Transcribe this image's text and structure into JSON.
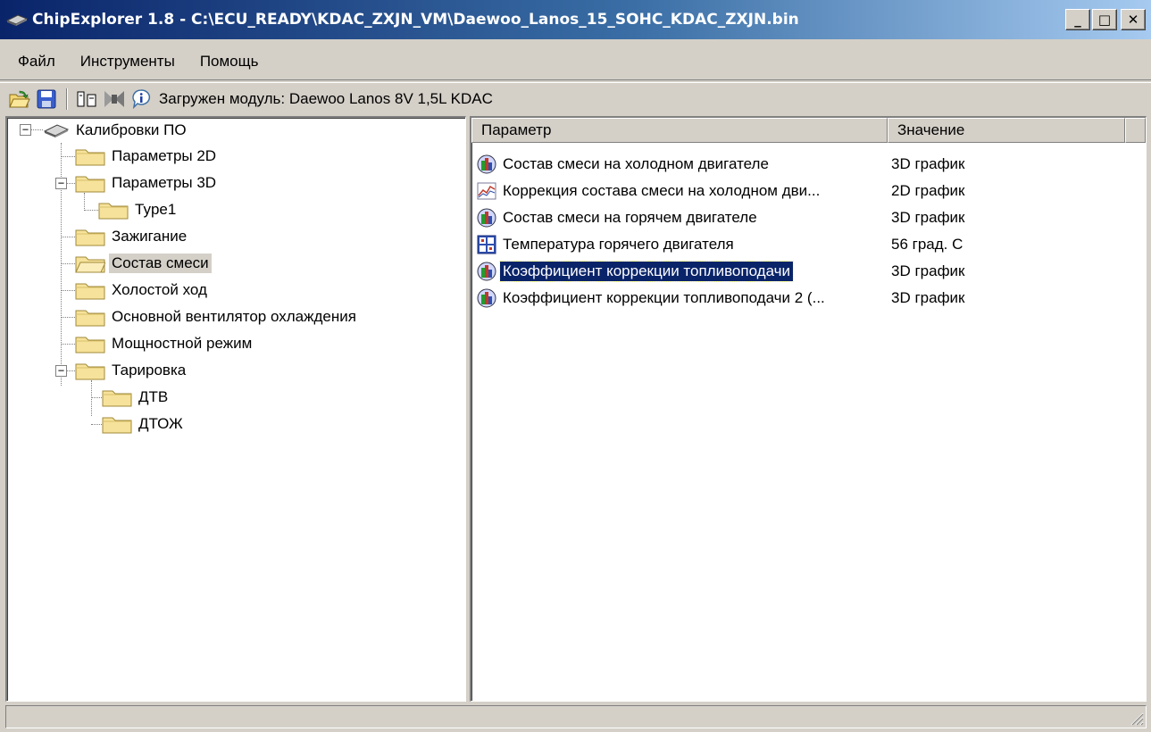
{
  "window": {
    "title": "ChipExplorer  1.8 - C:\\ECU_READY\\KDAC_ZXJN_VM\\Daewoo_Lanos_15_SOHC_KDAC_ZXJN.bin",
    "minimize": "_",
    "maximize": "□",
    "close": "✕"
  },
  "menu": {
    "file": "Файл",
    "tools": "Инструменты",
    "help": "Помощь"
  },
  "toolbar": {
    "module_status": "Загружен модуль: Daewoo Lanos 8V 1,5L KDAC",
    "icons": [
      "open-icon",
      "save-icon",
      "compare-icon",
      "checksum-icon",
      "info-icon"
    ]
  },
  "tree": {
    "root": "Калибровки ПО",
    "params2d": "Параметры 2D",
    "params3d": "Параметры 3D",
    "type1": "Type1",
    "ignition": "Зажигание",
    "mixture": "Состав смеси",
    "idle": "Холостой ход",
    "fan": "Основной вентилятор охлаждения",
    "power": "Мощностной режим",
    "calibration": "Тарировка",
    "dtv": "ДТВ",
    "dtozh": "ДТОЖ"
  },
  "list": {
    "col_param": "Параметр",
    "col_value": "Значение",
    "rows": [
      {
        "name": "Состав смеси на холодном двигателе",
        "value": "3D график",
        "icon": "chart3d-icon"
      },
      {
        "name": "Коррекция состава смеси на холодном дви...",
        "value": "2D график",
        "icon": "chart2d-icon"
      },
      {
        "name": "Состав смеси на горячем двигателе",
        "value": "3D график",
        "icon": "chart3d-icon"
      },
      {
        "name": "Температура горячего двигателя",
        "value": "56 град. С",
        "icon": "numeric-value-icon"
      },
      {
        "name": "Коэффициент коррекции топливоподачи",
        "value": "3D график",
        "icon": "chart3d-icon",
        "selected": true
      },
      {
        "name": "Коэффициент коррекции топливоподачи 2 (...",
        "value": "3D график",
        "icon": "chart3d-icon"
      }
    ]
  },
  "status": {
    "text": ""
  }
}
